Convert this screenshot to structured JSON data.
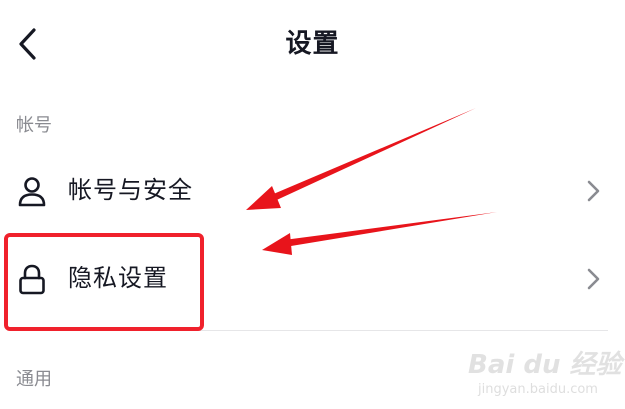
{
  "header": {
    "title": "设置",
    "back_icon": "chevron-left-icon"
  },
  "sections": {
    "account": {
      "label": "帐号",
      "items": [
        {
          "label": "帐号与安全",
          "icon": "user-icon"
        },
        {
          "label": "隐私设置",
          "icon": "lock-icon",
          "highlighted": true
        }
      ]
    },
    "general": {
      "label": "通用"
    }
  },
  "annotation": {
    "highlight_color": "#f0212c",
    "arrow_color": "#e8141b"
  },
  "watermark": {
    "brand": "Bai du 经验",
    "url": "jingyan.baidu.com"
  }
}
